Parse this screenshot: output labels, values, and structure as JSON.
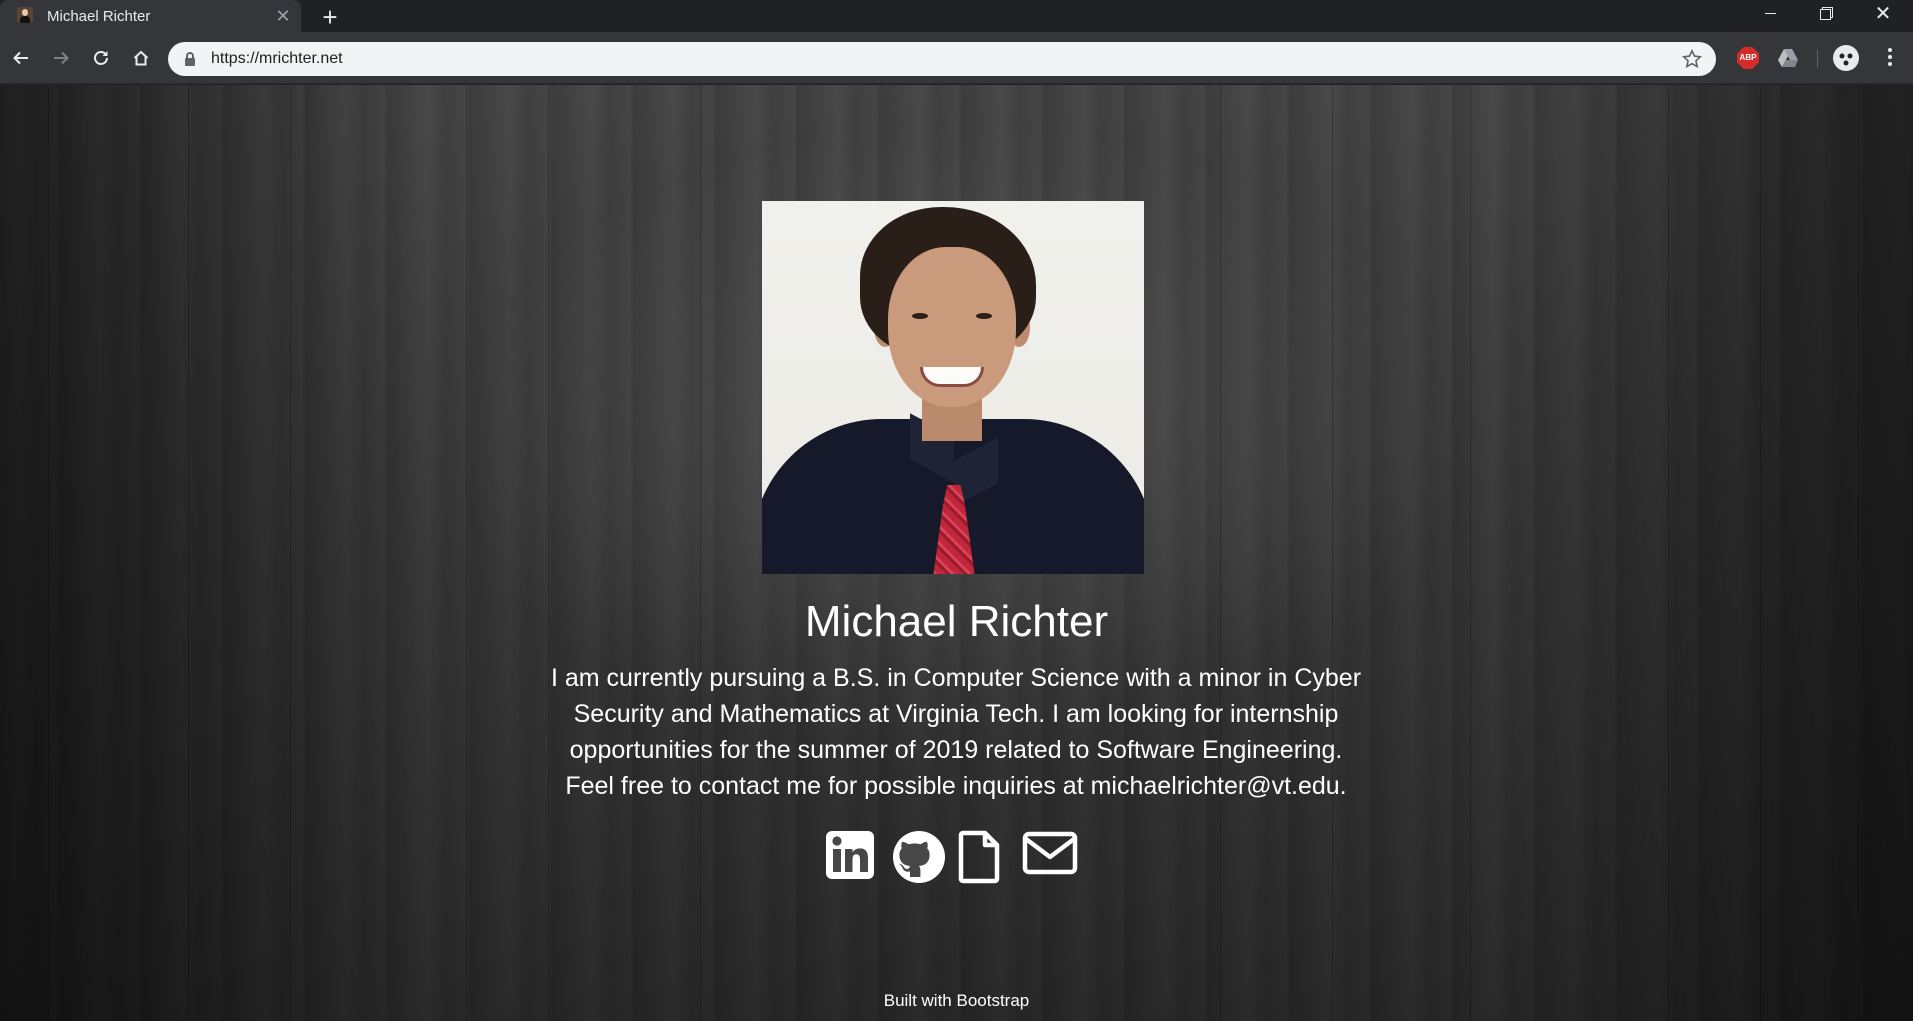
{
  "browser": {
    "tab": {
      "title": "Michael Richter",
      "close_glyph": "✕"
    },
    "new_tab_glyph": "+",
    "window_close_glyph": "✕",
    "url": "https://mrichter.net",
    "extensions": {
      "abp_label": "ABP"
    }
  },
  "page": {
    "name": "Michael Richter",
    "bio_lines": [
      "I am currently pursuing a B.S. in Computer Science with a minor in Cyber",
      "Security and Mathematics at Virginia Tech. I am looking for internship",
      "opportunities for the summer of 2019 related to Software Engineering.",
      "Feel free to contact me for possible inquiries at michaelrichter@vt.edu."
    ],
    "social_icons": [
      "linkedin-icon",
      "github-icon",
      "file-icon",
      "envelope-icon"
    ],
    "footer": "Built with Bootstrap"
  },
  "colors": {
    "chrome_dark": "#202124",
    "chrome_tab": "#35363a",
    "page_text": "#ffffff",
    "abp_red": "#d42b2b"
  }
}
